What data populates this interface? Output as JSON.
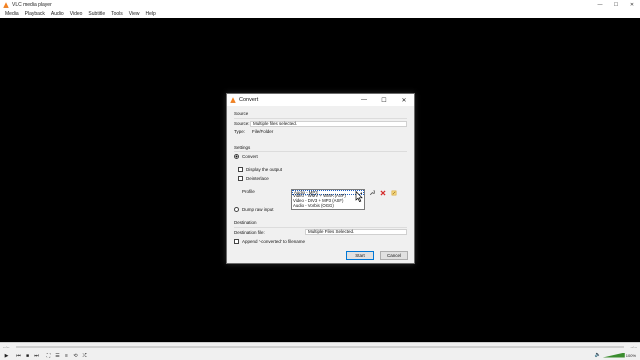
{
  "window": {
    "title": "VLC media player",
    "controls": [
      "—",
      "☐",
      "✕"
    ]
  },
  "menu": [
    "Media",
    "Playback",
    "Audio",
    "Video",
    "Subtitle",
    "Tools",
    "View",
    "Help"
  ],
  "player": {
    "elapsed": "--:--",
    "total": "--:--",
    "volume_text": "100%",
    "volume_level": 1.0
  },
  "dialog": {
    "title": "Convert",
    "source_section": "Source",
    "source_label": "Source:",
    "source_value": "Multiple files selected.",
    "type_label": "Type:",
    "type_value": "File/Folder",
    "settings_section": "Settings",
    "convert_label": "Convert",
    "display_output_label": "Display the output",
    "deinterlace_label": "Deinterlace",
    "profile_label": "Profile",
    "profile_options": [
      "Video - WMV + WMA (ASF)",
      "Video - DIV3 + MP3 (ASF)",
      "Audio - Vorbis (OGG)"
    ],
    "profile_selected": "Audio - MP3",
    "dump_raw_label": "Dump raw input",
    "destination_section": "Destination",
    "dest_file_label": "Destination file:",
    "dest_file_value": "Multiple Files Selected.",
    "append_label": "Append '-converted' to filename",
    "start_label": "Start",
    "cancel_label": "Cancel"
  },
  "colors": {
    "accent": "#0078d7",
    "delete": "#d42a2a",
    "edit": "#d8a227",
    "volume": "#3a8c2e",
    "vlc_orange": "#f58220"
  }
}
